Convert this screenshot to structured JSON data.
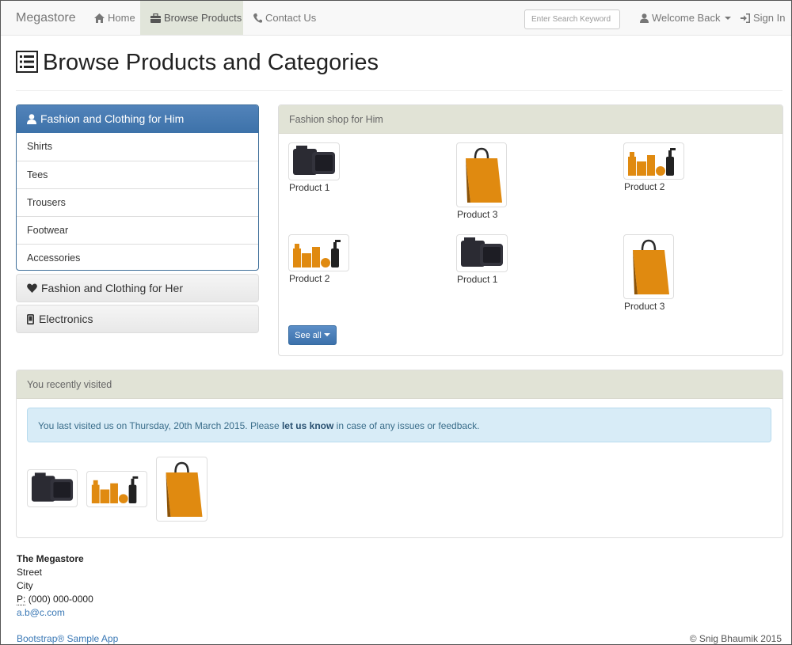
{
  "navbar": {
    "brand": "Megastore",
    "home": "Home",
    "browse": "Browse Products",
    "contact": "Contact Us",
    "search_placeholder": "Enter Search Keyword",
    "welcome": "Welcome Back",
    "signin": "Sign In"
  },
  "header": {
    "title": "Browse Products and Categories"
  },
  "sidebar": {
    "primary": {
      "title": "Fashion and Clothing for Him",
      "items": [
        "Shirts",
        "Tees",
        "Trousers",
        "Footwear",
        "Accessories"
      ]
    },
    "her": "Fashion and Clothing for Her",
    "electronics": "Electronics"
  },
  "shop": {
    "title": "Fashion shop for Him",
    "products": [
      {
        "label": "Product 1",
        "icon": "camera-icon"
      },
      {
        "label": "Product 3",
        "icon": "shopping-bag-icon"
      },
      {
        "label": "Product 2",
        "icon": "cosmetics-icon"
      },
      {
        "label": "Product 2",
        "icon": "cosmetics-icon"
      },
      {
        "label": "Product 1",
        "icon": "camera-icon"
      },
      {
        "label": "Product 3",
        "icon": "shopping-bag-icon"
      }
    ],
    "see_all": "See all"
  },
  "recent": {
    "title": "You recently visited",
    "alert_prefix": "You last visited us on Thursday, 20th March 2015. Please ",
    "alert_link": "let us know",
    "alert_suffix": " in case of any issues or feedback."
  },
  "footer": {
    "company": "The Megastore",
    "street": "Street",
    "city": "City",
    "phone_label": "P:",
    "phone": "(000) 000-0000",
    "email": "a.b@c.com",
    "left": "Bootstrap® Sample App",
    "right": "© Snig Bhaumik 2015"
  },
  "colors": {
    "primary": "#4b7bb5",
    "panel_head": "#e1e3d6",
    "accent_orange": "#e08a10",
    "alert_bg": "#d8ecf7"
  }
}
